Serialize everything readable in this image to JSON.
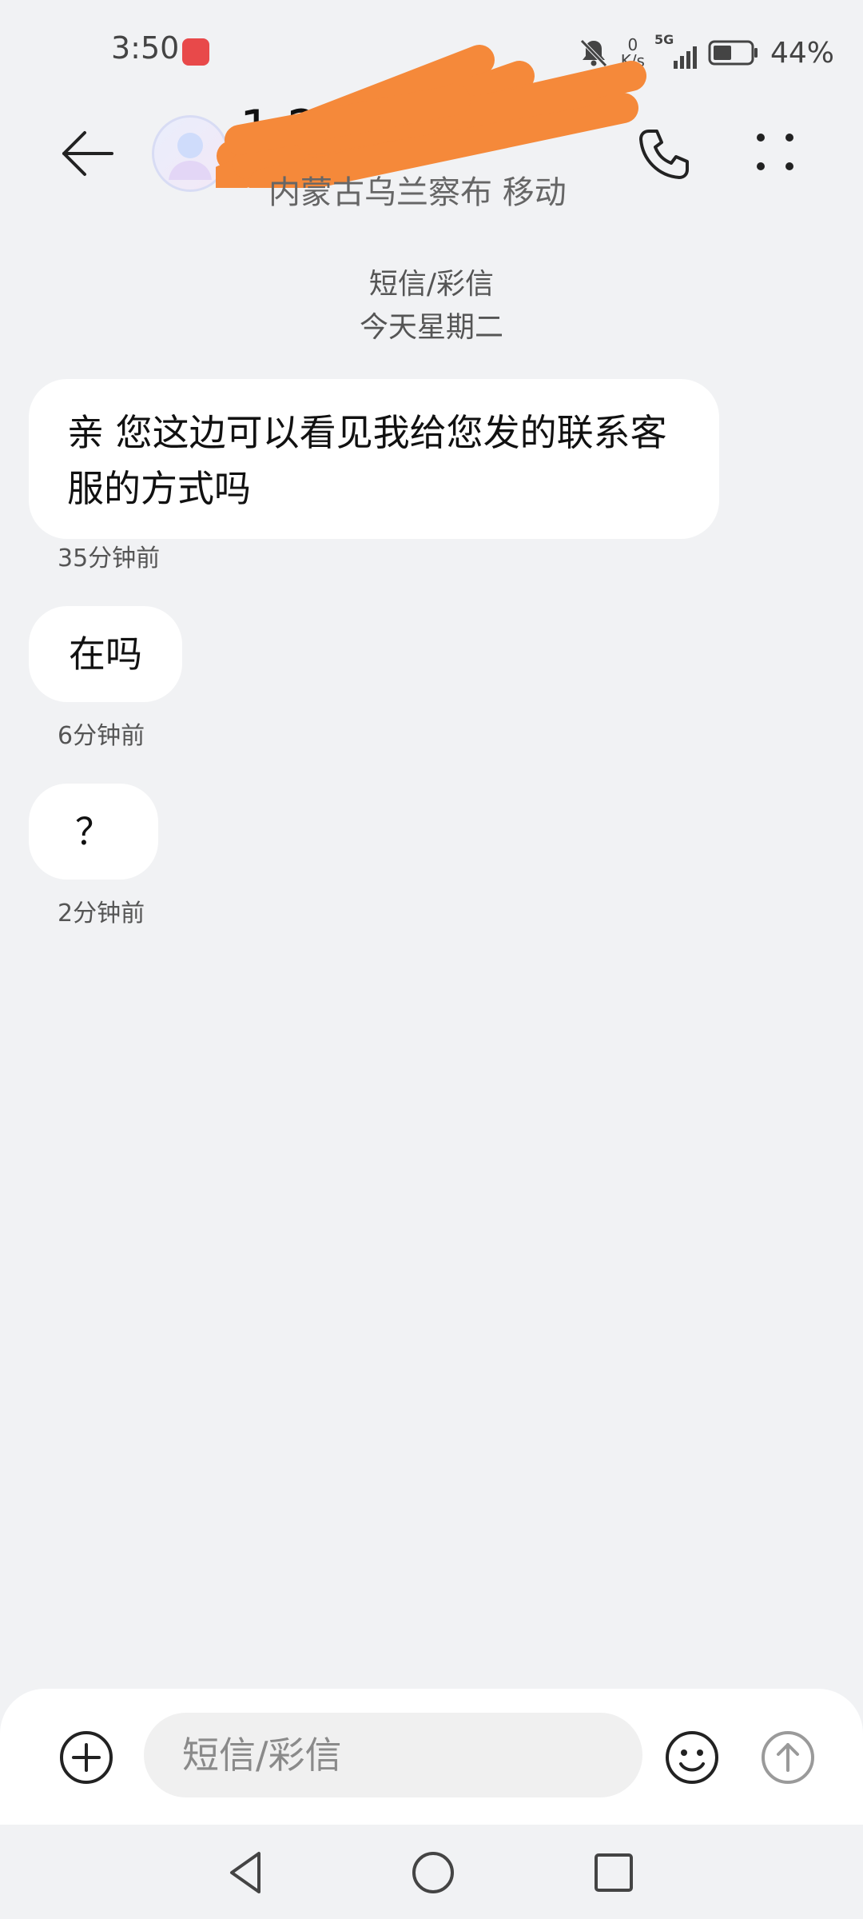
{
  "status_bar": {
    "time": "3:50",
    "net_speed_value": "0",
    "net_speed_unit": "K/s",
    "network_type": "5G",
    "battery_percent": "44%",
    "icons": [
      "app-store-badge-icon",
      "mute-bell-icon",
      "signal-icon",
      "battery-icon"
    ]
  },
  "header": {
    "contact_name": "1 27",
    "contact_subtitle": "内蒙古乌兰察布 移动",
    "icons": [
      "back-arrow-icon",
      "avatar-icon",
      "phone-icon",
      "more-icon"
    ]
  },
  "conversation": {
    "channel_label": "短信/彩信",
    "date_label": "今天星期二",
    "messages": [
      {
        "text": "亲 您这边可以看见我给您发的联系客服的方式吗",
        "time": "35分钟前"
      },
      {
        "text": "在吗",
        "time": "6分钟前"
      },
      {
        "text": "？",
        "time": "2分钟前"
      }
    ]
  },
  "composer": {
    "placeholder": "短信/彩信",
    "value": "",
    "icons": [
      "add-icon",
      "emoji-icon",
      "send-icon"
    ]
  },
  "navbar": {
    "icons": [
      "nav-back-icon",
      "nav-home-icon",
      "nav-recents-icon"
    ]
  },
  "colors": {
    "background": "#f1f2f4",
    "bubble": "#ffffff",
    "redaction": "#f5893a"
  }
}
